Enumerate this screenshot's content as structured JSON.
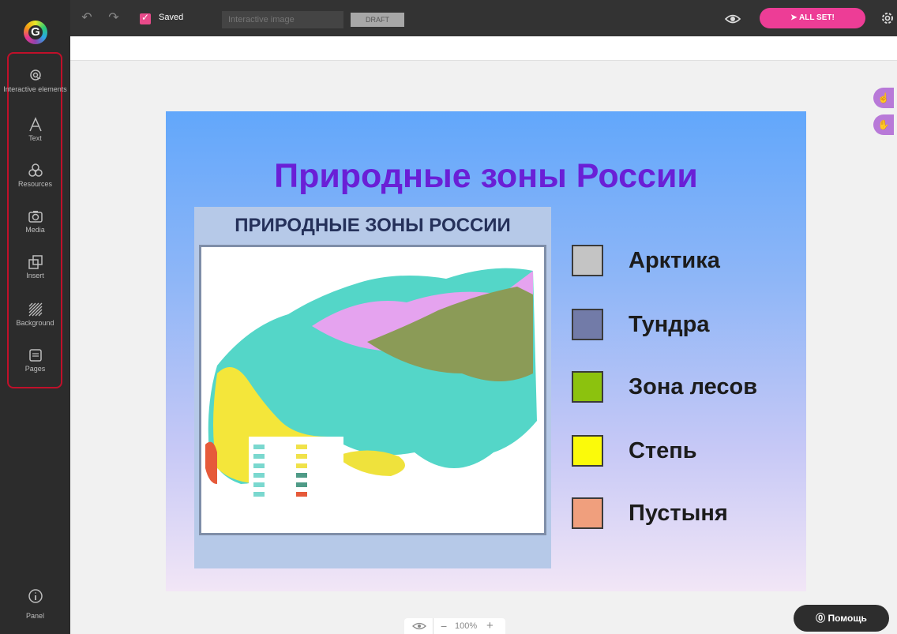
{
  "sidebar": {
    "logo_letter": "G",
    "items": [
      {
        "label": "Interactive elements",
        "icon": "interactive-icon"
      },
      {
        "label": "Text",
        "icon": "text-icon"
      },
      {
        "label": "Resources",
        "icon": "resources-icon"
      },
      {
        "label": "Media",
        "icon": "camera-icon"
      },
      {
        "label": "Insert",
        "icon": "insert-icon"
      },
      {
        "label": "Background",
        "icon": "background-icon"
      },
      {
        "label": "Pages",
        "icon": "pages-icon"
      }
    ],
    "panel_label": "Panel"
  },
  "toolbar": {
    "saved_label": "Saved",
    "title_placeholder": "Interactive image",
    "draft_label": "DRAFT",
    "allset_label": "ALL SET!"
  },
  "canvas": {
    "title": "Природные зоны России",
    "map_title": "ПРИРОДНЫЕ ЗОНЫ РОССИИ",
    "legend": [
      {
        "label": "Арктика",
        "color": "#c4c4c4"
      },
      {
        "label": "Тундра",
        "color": "#727ba8"
      },
      {
        "label": "Зона лесов",
        "color": "#8cc20e"
      },
      {
        "label": "Степь",
        "color": "#fbfa0a"
      },
      {
        "label": "Пустыня",
        "color": "#f09f7d"
      }
    ]
  },
  "bottom": {
    "zoom": "100%",
    "help_label": "Помощь"
  },
  "colors": {
    "accent": "#ed3d96",
    "sidebar_bg": "#2c2c2c",
    "title_purple": "#6a1fd6"
  }
}
